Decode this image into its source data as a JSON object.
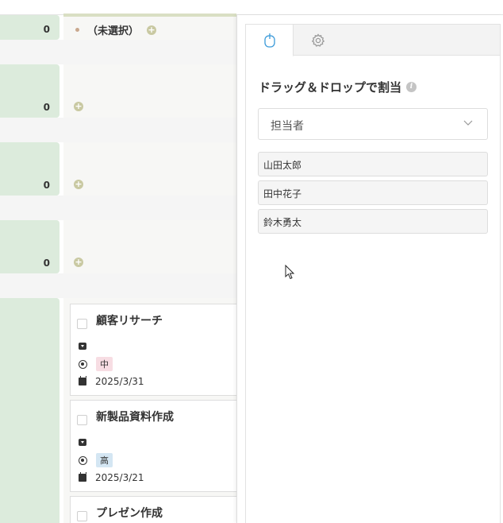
{
  "board": {
    "lanes": [
      {
        "count": "0",
        "label": "（未選択）"
      },
      {
        "count": "0"
      },
      {
        "count": "0"
      },
      {
        "count": "0"
      }
    ],
    "add_label": "+",
    "cards": [
      {
        "title": "顧客リサーチ",
        "priority": "中",
        "priority_color": "#f7dde3",
        "date": "2025/3/31"
      },
      {
        "title": "新製品資料作成",
        "priority": "高",
        "priority_color": "#d4e6f3",
        "date": "2025/3/21"
      },
      {
        "title": "プレゼン作成"
      }
    ]
  },
  "panel": {
    "tabs": [
      {
        "icon": "mouse-icon",
        "active": true
      },
      {
        "icon": "gear-icon",
        "active": false
      }
    ],
    "title": "ドラッグ＆ドロップで割当",
    "info_label": "i",
    "select": {
      "value": "担当者"
    },
    "assignees": [
      "山田太郎",
      "田中花子",
      "鈴木勇太"
    ]
  },
  "colors": {
    "accent": "#3a9ad9",
    "lane_green": "#dcebdc",
    "icon_gray": "#9a9a9a"
  }
}
